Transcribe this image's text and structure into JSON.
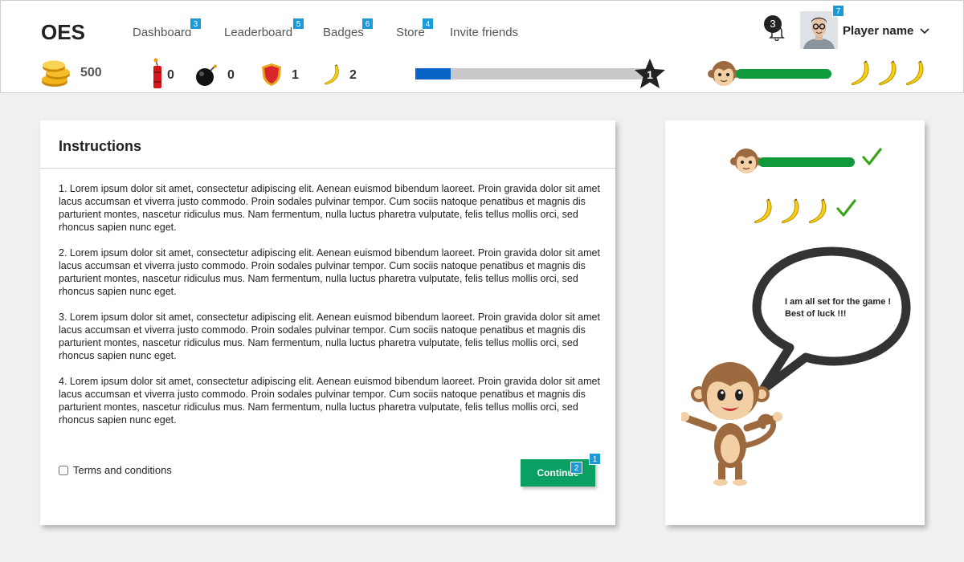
{
  "header": {
    "logo": "OES",
    "nav": [
      {
        "label": "Dashboard",
        "badge": "3"
      },
      {
        "label": "Leaderboard",
        "badge": "5"
      },
      {
        "label": "Badges",
        "badge": "6"
      },
      {
        "label": "Store",
        "badge": "4"
      },
      {
        "label": "Invite friends"
      }
    ],
    "notifications": "3",
    "player_name": "Player name",
    "player_badge": "7"
  },
  "stats": {
    "coins": "500",
    "dynamite": "0",
    "bombs": "0",
    "shields": "1",
    "bananas": "2",
    "level": "1",
    "level_progress_fraction": 0.15,
    "banana_lives_count": 3
  },
  "instructions": {
    "title": "Instructions",
    "paragraphs": [
      "1. Lorem ipsum dolor sit amet, consectetur adipiscing elit. Aenean euismod bibendum laoreet. Proin gravida dolor sit amet lacus accumsan et viverra justo commodo. Proin sodales pulvinar tempor. Cum sociis natoque penatibus et magnis dis parturient montes, nascetur ridiculus mus. Nam fermentum, nulla luctus pharetra vulputate, felis tellus mollis orci, sed rhoncus sapien nunc eget.",
      "2. Lorem ipsum dolor sit amet, consectetur adipiscing elit. Aenean euismod bibendum laoreet. Proin gravida dolor sit amet lacus accumsan et viverra justo commodo. Proin sodales pulvinar tempor. Cum sociis natoque penatibus et magnis dis parturient montes, nascetur ridiculus mus. Nam fermentum, nulla luctus pharetra vulputate, felis tellus mollis orci, sed rhoncus sapien nunc eget.",
      "3. Lorem ipsum dolor sit amet, consectetur adipiscing elit. Aenean euismod bibendum laoreet. Proin gravida dolor sit amet lacus accumsan et viverra justo commodo. Proin sodales pulvinar tempor. Cum sociis natoque penatibus et magnis dis parturient montes, nascetur ridiculus mus. Nam fermentum, nulla luctus pharetra vulputate, felis tellus mollis orci, sed rhoncus sapien nunc eget.",
      "4. Lorem ipsum dolor sit amet, consectetur adipiscing elit. Aenean euismod bibendum laoreet. Proin gravida dolor sit amet lacus accumsan et viverra justo commodo. Proin sodales pulvinar tempor. Cum sociis natoque penatibus et magnis dis parturient montes, nascetur ridiculus mus. Nam fermentum, nulla luctus pharetra vulputate, felis tellus mollis orci, sed rhoncus sapien nunc eget."
    ],
    "terms_label": "Terms and conditions",
    "continue_label": "Continue",
    "continue_badge_a": "1",
    "continue_badge_b": "2"
  },
  "side": {
    "speech": "I am all set for the game ! Best of luck !!!"
  },
  "colors": {
    "accent_blue": "#1a9bd7",
    "progress_blue": "#0a64c8",
    "health_green": "#109a3c",
    "button_green": "#0a9f63",
    "check_green": "#3aa51b"
  }
}
